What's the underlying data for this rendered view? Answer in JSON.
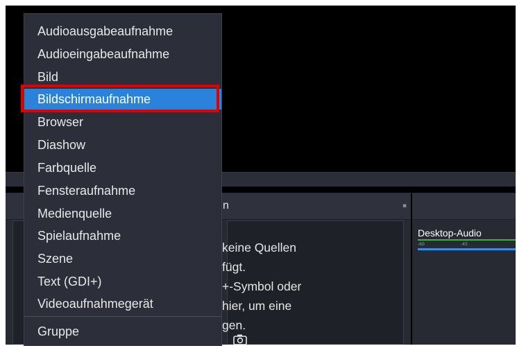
{
  "menu": {
    "items": [
      {
        "label": "Audioausgabeaufnahme"
      },
      {
        "label": "Audioeingabeaufnahme"
      },
      {
        "label": "Bild"
      },
      {
        "label": "Bildschirmaufnahme",
        "selected": true
      },
      {
        "label": "Browser"
      },
      {
        "label": "Diashow"
      },
      {
        "label": "Farbquelle"
      },
      {
        "label": "Fensteraufnahme"
      },
      {
        "label": "Medienquelle"
      },
      {
        "label": "Spielaufnahme"
      },
      {
        "label": "Szene"
      },
      {
        "label": "Text (GDI+)"
      },
      {
        "label": "Videoaufnahmegerät"
      }
    ],
    "group_label": "Gruppe"
  },
  "sources_dock": {
    "title_partial": "n",
    "empty_text": "keine Quellen\nfügt.\n+-Symbol oder\nhier, um eine\ngen."
  },
  "mixer_dock": {
    "track_name": "Desktop-Audio",
    "tick_labels": [
      "-60",
      "-45"
    ]
  },
  "colors": {
    "selection": "#2a82da",
    "callout": "#e00000",
    "meter": "#3db14a"
  }
}
